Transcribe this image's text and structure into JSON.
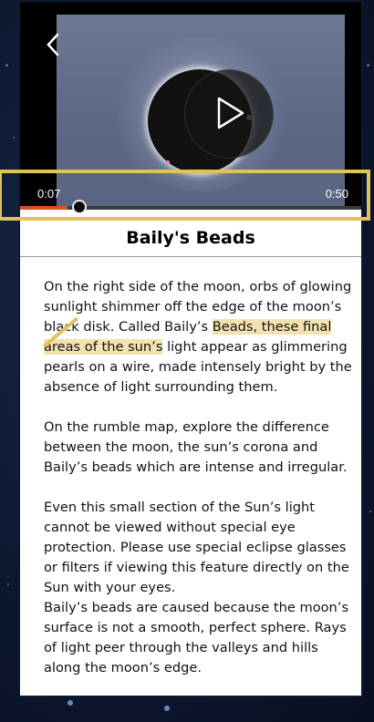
{
  "video": {
    "time_elapsed": "0:07",
    "time_total": "0:50",
    "progress": 0.14
  },
  "content": {
    "title": "Baily's Beads",
    "p1_before": "On the right side of the moon, orbs of glowing sunlight shimmer off the edge of the moon’s black disk. Called Baily’s ",
    "p1_highlight": "Beads, these final areas of the sun’s",
    "p1_after": " light appear as glimmering pearls on a wire, made intensely bright by the absence of light surrounding them.",
    "p2": "On the rumble map, explore the difference between the moon, the sun’s corona and Baily’s beads which are intense and irregular.",
    "p3": "Even this small section of the Sun’s light cannot be viewed without special eye protection. Please use special eclipse glasses or filters if viewing this feature directly on the Sun with your eyes.",
    "p4": "Baily’s beads are caused because the moon’s surface is not a smooth, perfect sphere. Rays of light peer through the valleys and hills along the moon’s edge."
  },
  "colors": {
    "annotation": "#e0c15d",
    "progress_fill": "#d9531e",
    "text_highlight": "#f1e2b0"
  },
  "icons": [
    "back-arrow-icon",
    "play-icon"
  ]
}
